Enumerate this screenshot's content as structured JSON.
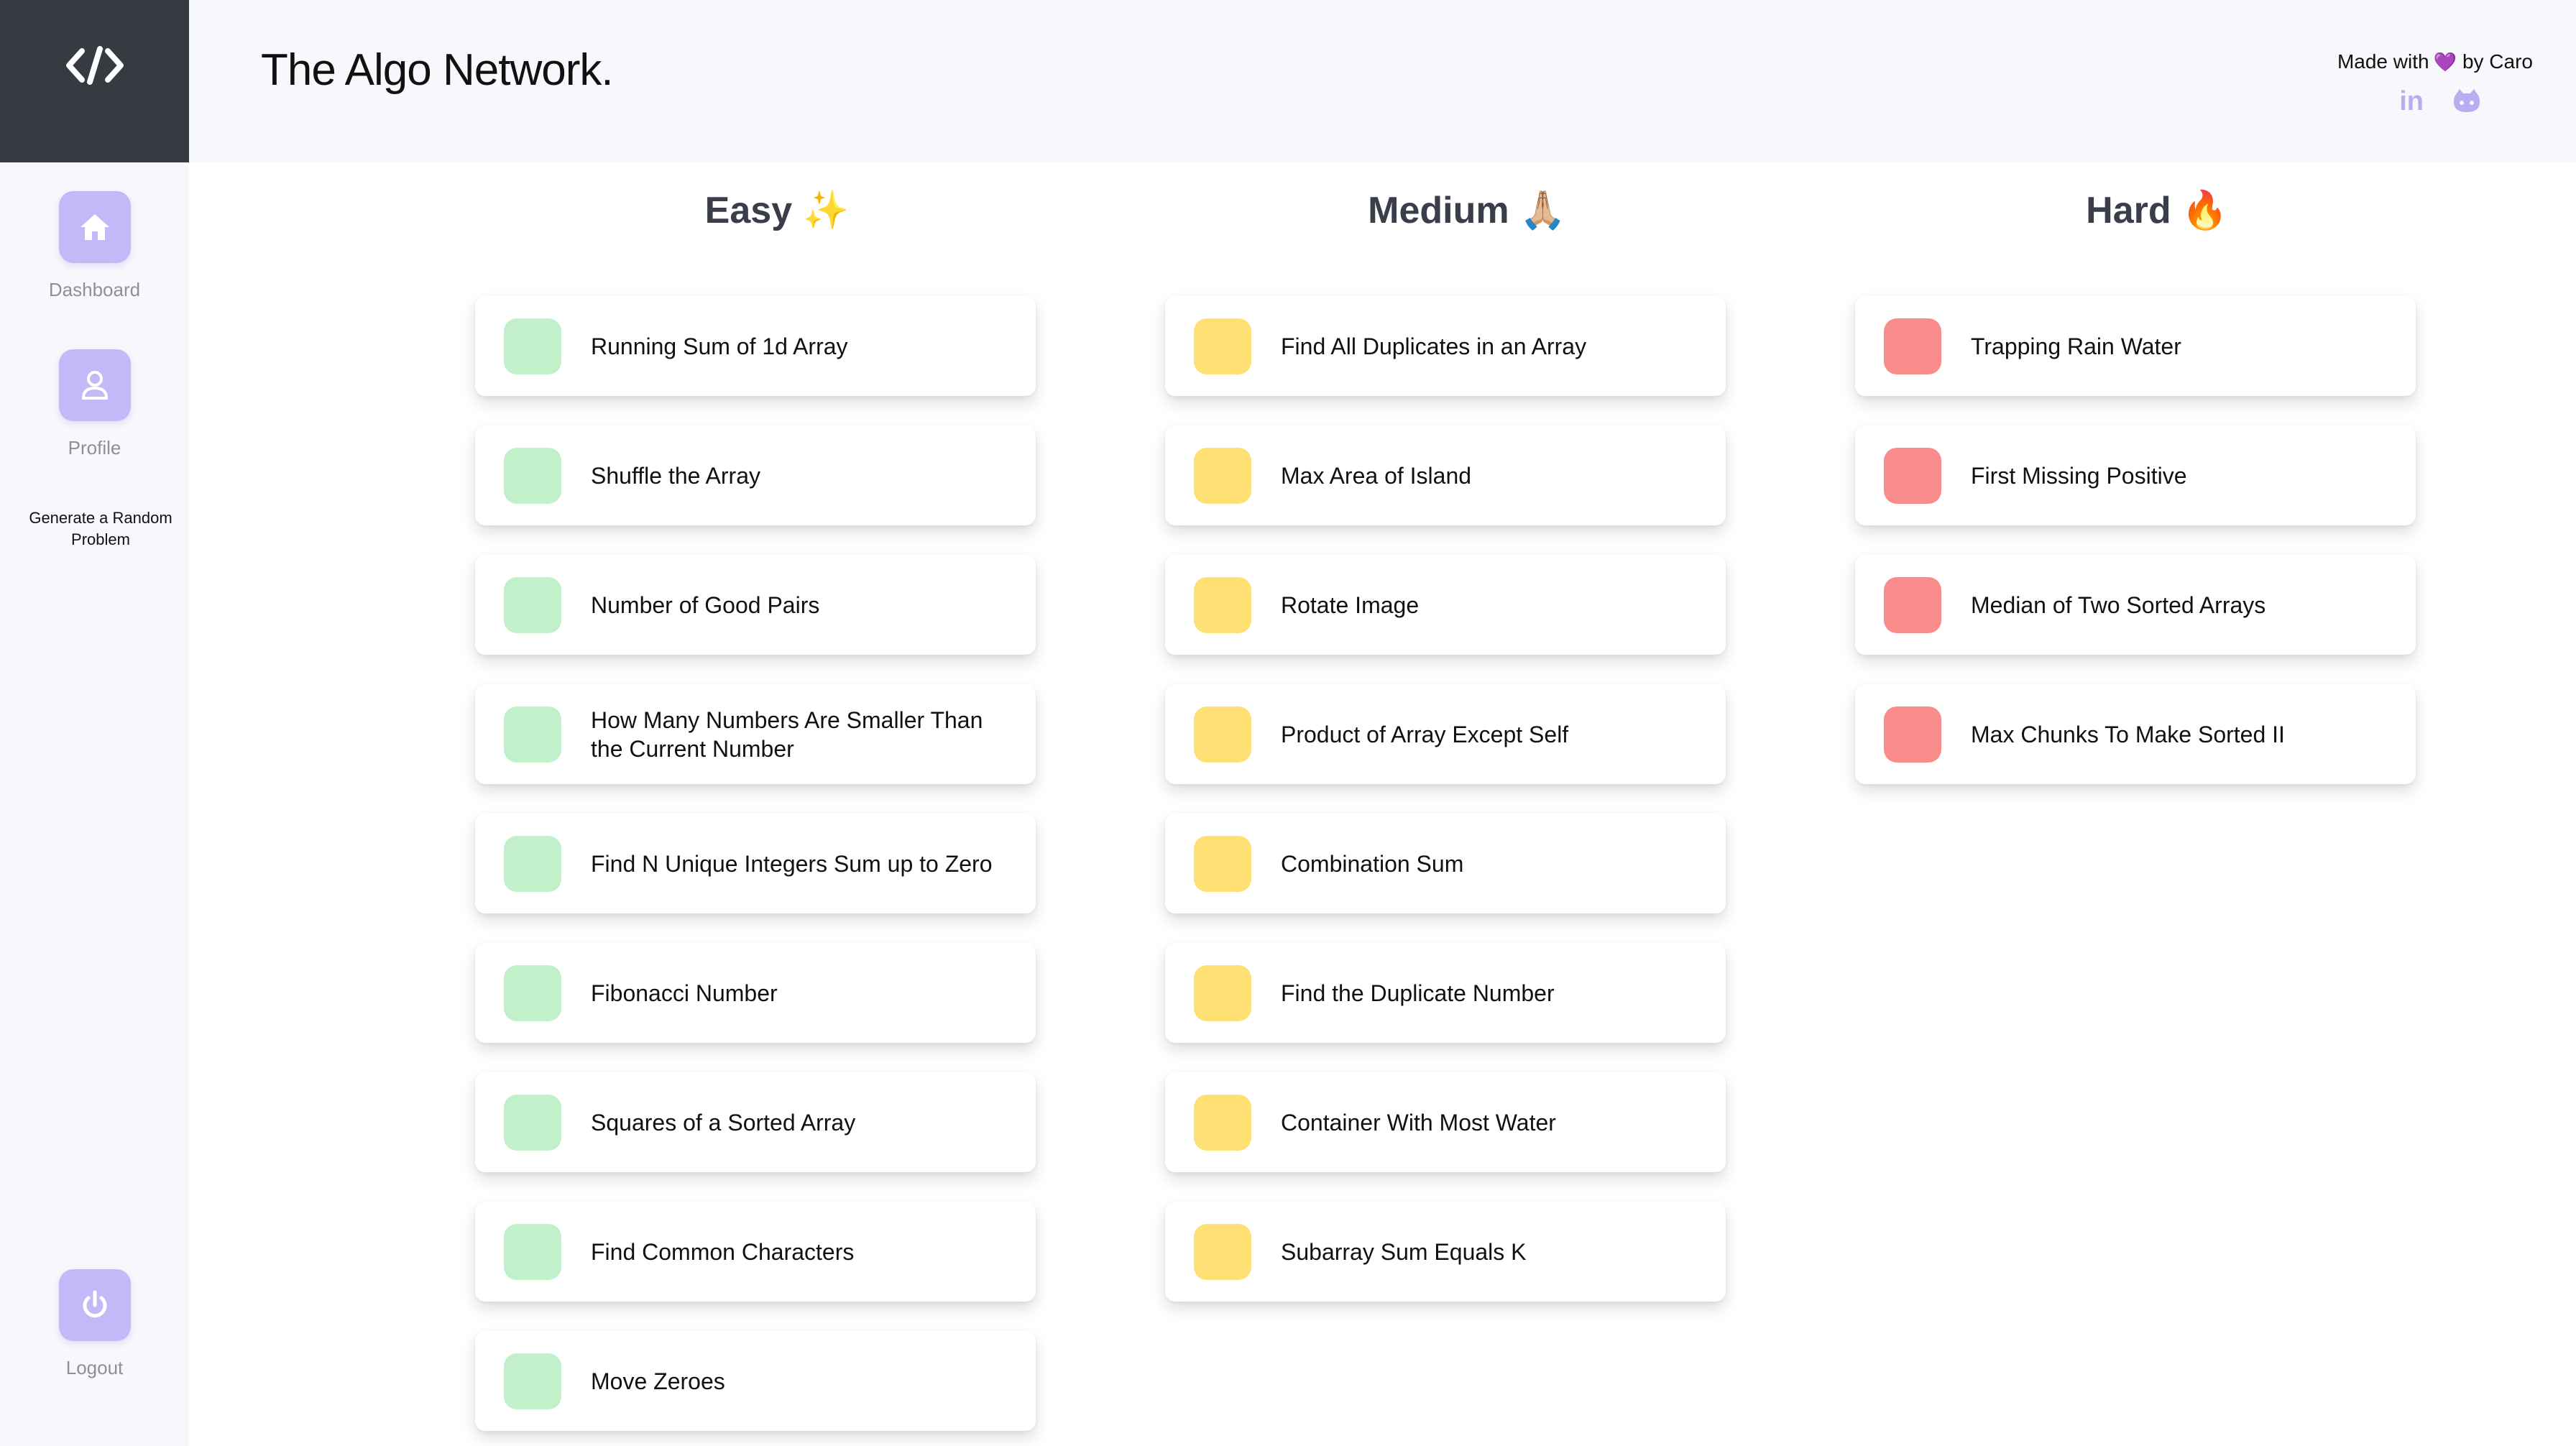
{
  "app": {
    "title": "The Algo Network.",
    "credit_prefix": "Made with",
    "credit_suffix": "by Caro",
    "heart": "💜",
    "linkedin": "in"
  },
  "sidebar": {
    "items": [
      {
        "label": "Dashboard",
        "icon": "home-icon"
      },
      {
        "label": "Profile",
        "icon": "user-icon"
      }
    ],
    "random_label": "Generate a Random Problem",
    "logout_label": "Logout"
  },
  "columns": [
    {
      "title": "Easy ✨",
      "color": "#c2f0cb",
      "problems": [
        "Running Sum of 1d Array",
        "Shuffle the Array",
        "Number of Good Pairs",
        "How Many Numbers Are Smaller Than the Current Number",
        "Find N Unique Integers Sum up to Zero",
        "Fibonacci Number",
        "Squares of a Sorted Array",
        "Find Common Characters",
        "Move Zeroes"
      ]
    },
    {
      "title": "Medium 🙏🏼",
      "color": "#ffe074",
      "problems": [
        "Find All Duplicates in an Array",
        "Max Area of Island",
        "Rotate Image",
        "Product of Array Except Self",
        "Combination Sum",
        "Find the Duplicate Number",
        "Container With Most Water",
        "Subarray Sum Equals K"
      ]
    },
    {
      "title": "Hard 🔥",
      "color": "#fb8c8c",
      "problems": [
        "Trapping Rain Water",
        "First Missing Positive",
        "Median of Two Sorted Arrays",
        "Max Chunks To Make Sorted II"
      ]
    }
  ]
}
